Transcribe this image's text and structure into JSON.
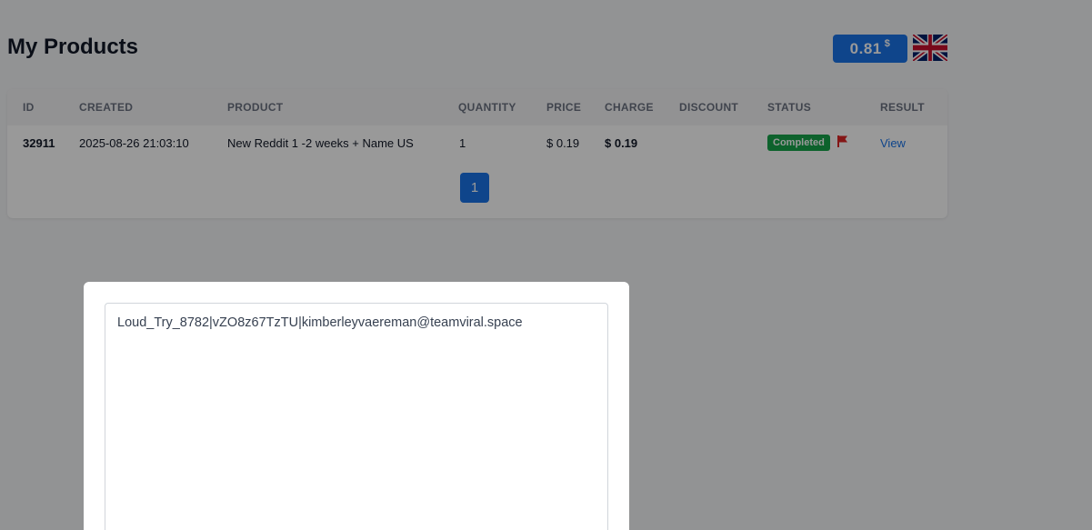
{
  "header": {
    "title": "My Products",
    "balance_value": "0.81",
    "balance_currency": "$",
    "language_flag": "uk-flag-icon"
  },
  "table": {
    "columns": [
      "ID",
      "CREATED",
      "PRODUCT",
      "QUANTITY",
      "PRICE",
      "CHARGE",
      "DISCOUNT",
      "STATUS",
      "RESULT"
    ],
    "rows": [
      {
        "id": "32911",
        "created": "2025-08-26 21:03:10",
        "product": "New Reddit 1 -2 weeks + Name US",
        "quantity": "1",
        "price": "$ 0.19",
        "charge": "$ 0.19",
        "discount": "",
        "status": "Completed",
        "result": "View"
      }
    ]
  },
  "pagination": {
    "current_page": "1"
  },
  "colors": {
    "accent": "#1a73e8",
    "status_completed": "#16a34a",
    "report_flag": "#dc2626"
  },
  "modal": {
    "content": "Loud_Try_8782|vZO8z67TzTU|kimberleyvaereman@teamviral.space"
  }
}
